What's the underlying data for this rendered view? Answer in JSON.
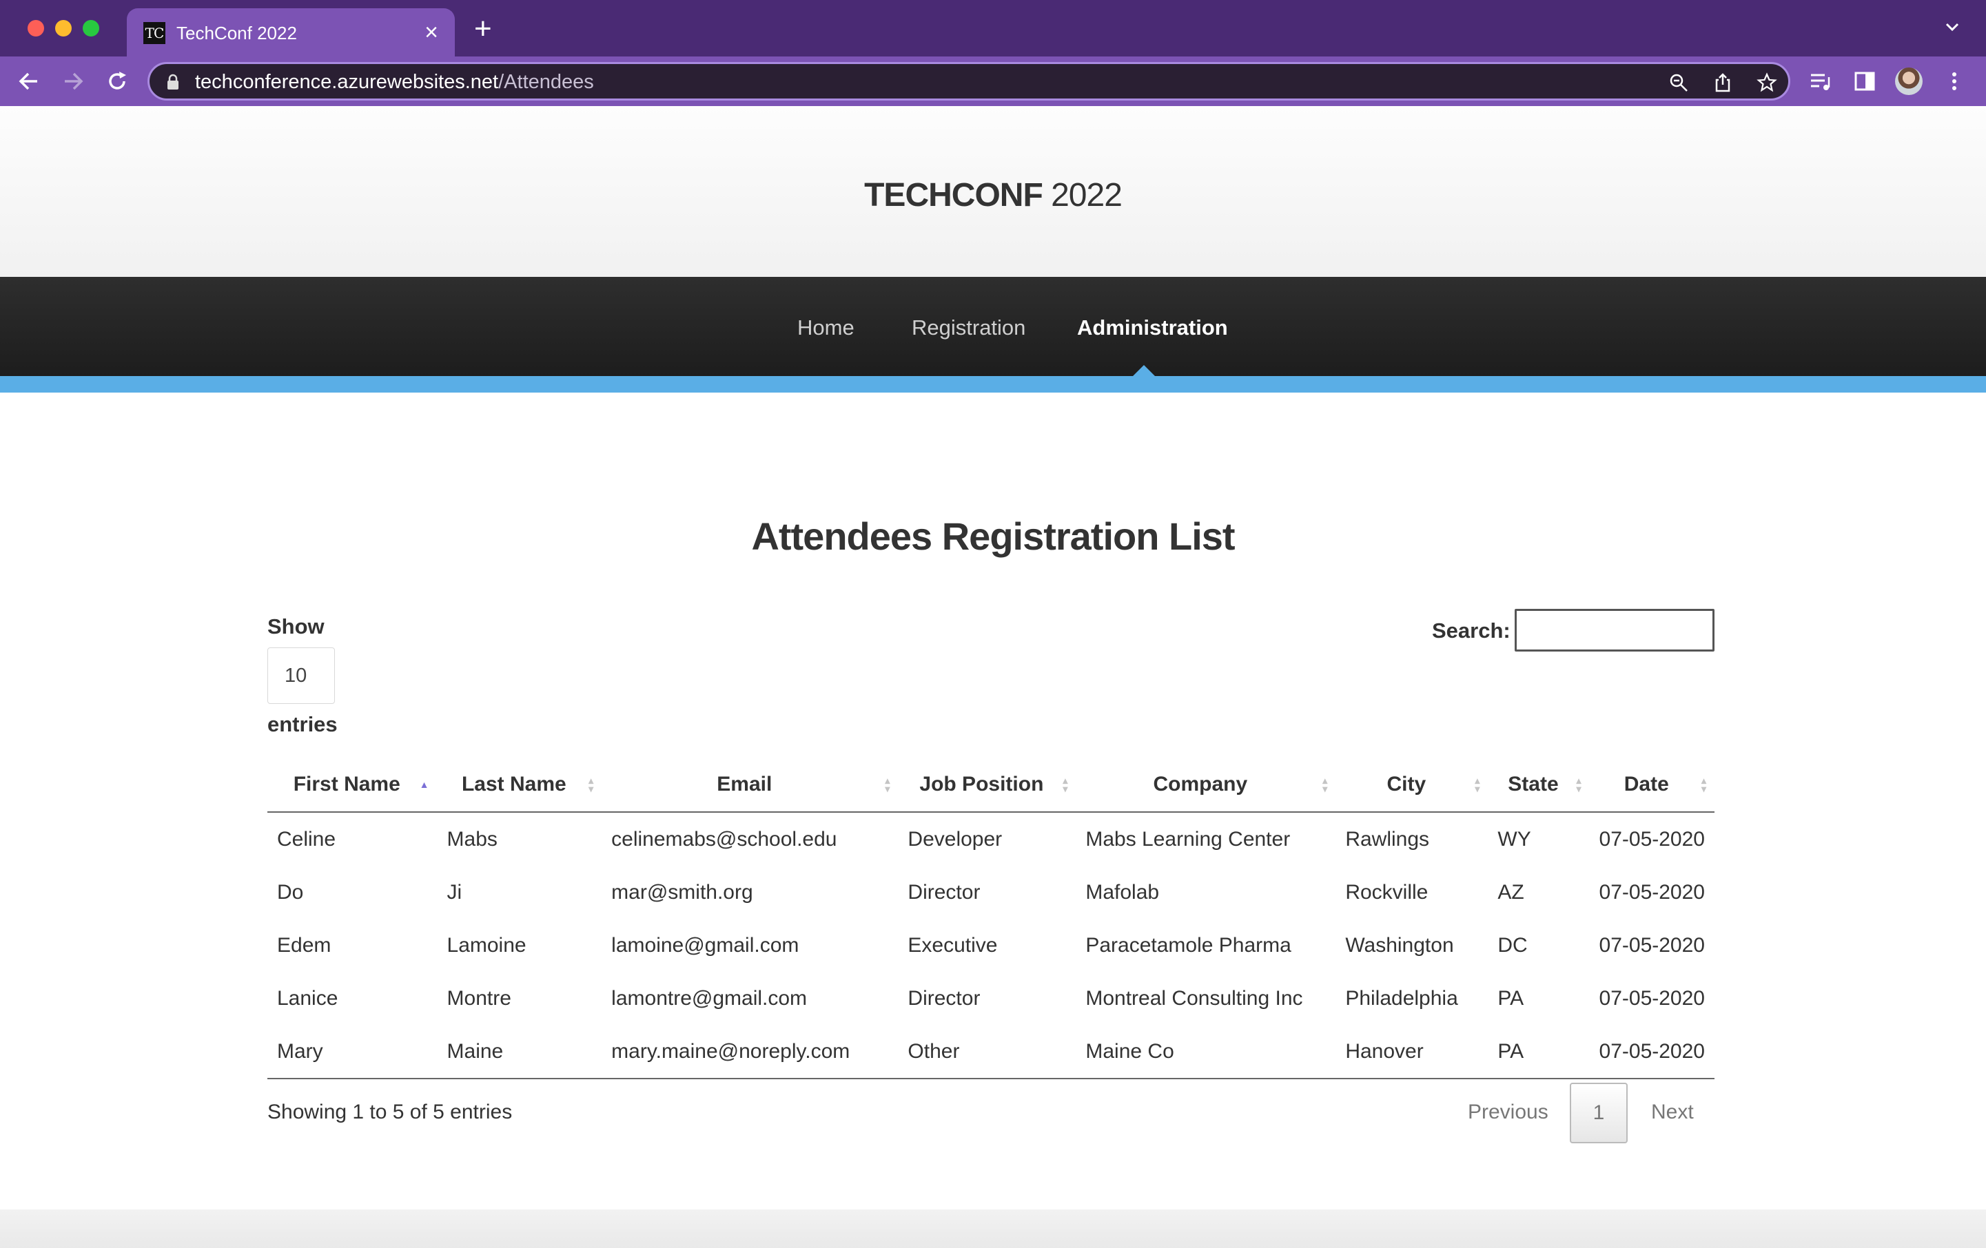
{
  "browser": {
    "tab_favicon": "TC",
    "tab_title": "TechConf 2022",
    "url_host": "techconference.azurewebsites.net",
    "url_path": "/Attendees"
  },
  "site": {
    "brand_bold": "TECHCONF",
    "brand_year": " 2022"
  },
  "nav": {
    "items": [
      {
        "label": "Home"
      },
      {
        "label": "Registration"
      },
      {
        "label": "Administration"
      }
    ],
    "active": "Administration"
  },
  "main": {
    "title": "Attendees Registration List",
    "show_label": "Show",
    "page_length": "10",
    "entries_label": "entries",
    "search_label": "Search:",
    "search_value": ""
  },
  "table": {
    "headers": [
      "First Name",
      "Last Name",
      "Email",
      "Job Position",
      "Company",
      "City",
      "State",
      "Date"
    ],
    "sorted_column": "First Name",
    "sort_direction": "ascending",
    "rows": [
      [
        "Celine",
        "Mabs",
        "celinemabs@school.edu",
        "Developer",
        "Mabs Learning Center",
        "Rawlings",
        "WY",
        "07-05-2020"
      ],
      [
        "Do",
        "Ji",
        "mar@smith.org",
        "Director",
        "Mafolab",
        "Rockville",
        "AZ",
        "07-05-2020"
      ],
      [
        "Edem",
        "Lamoine",
        "lamoine@gmail.com",
        "Executive",
        "Paracetamole Pharma",
        "Washington",
        "DC",
        "07-05-2020"
      ],
      [
        "Lanice",
        "Montre",
        "lamontre@gmail.com",
        "Director",
        "Montreal Consulting Inc",
        "Philadelphia",
        "PA",
        "07-05-2020"
      ],
      [
        "Mary",
        "Maine",
        "mary.maine@noreply.com",
        "Other",
        "Maine Co",
        "Hanover",
        "PA",
        "07-05-2020"
      ]
    ]
  },
  "pagination": {
    "info": "Showing 1 to 5 of 5 entries",
    "previous": "Previous",
    "current_page": "1",
    "next": "Next"
  },
  "colors": {
    "tab_bar": "#4a2a74",
    "toolbar": "#7c53b4",
    "nav_bar": "#262626",
    "accent_blue": "#5aaee6",
    "sort_active": "#7b6fd6"
  }
}
